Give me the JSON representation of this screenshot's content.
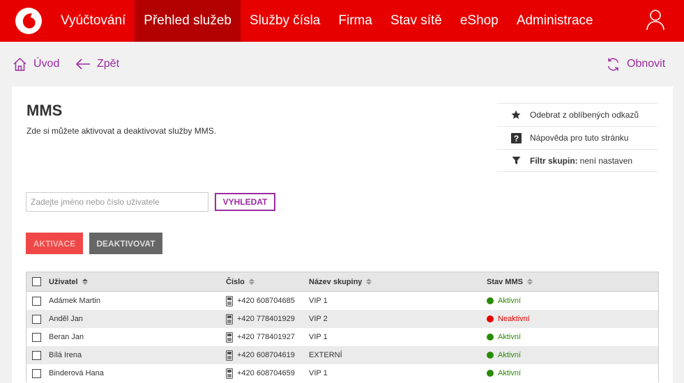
{
  "nav": {
    "items": [
      {
        "label": "Vyúčtování",
        "active": false
      },
      {
        "label": "Přehled služeb",
        "active": true
      },
      {
        "label": "Služby čísla",
        "active": false
      },
      {
        "label": "Firma",
        "active": false
      },
      {
        "label": "Stav sítě",
        "active": false
      },
      {
        "label": "eShop",
        "active": false
      },
      {
        "label": "Administrace",
        "active": false
      }
    ]
  },
  "breadcrumb": {
    "home": "Úvod",
    "back": "Zpět",
    "refresh": "Obnovit"
  },
  "page": {
    "title": "MMS",
    "description": "Zde si můžete aktivovat a deaktivovat služby MMS."
  },
  "sidebar": {
    "favorite": "Odebrat z oblíbených odkazů",
    "help": "Nápověda pro tuto stránku",
    "filter_label": "Filtr skupin:",
    "filter_value": "není nastaven"
  },
  "search": {
    "placeholder": "Zadejte jméno nebo číslo uživatele",
    "value": "",
    "button": "VYHLEDAT"
  },
  "actions": {
    "activate": "AKTIVACE",
    "deactivate": "DEAKTIVOVAT"
  },
  "table": {
    "headers": {
      "user": "Uživatel",
      "number": "Číslo",
      "group": "Název skupiny",
      "status": "Stav MMS"
    },
    "rows": [
      {
        "user": "Adámek Martin",
        "number": "+420 608704685",
        "group": "VIP 1",
        "status": "Aktivní",
        "active": true
      },
      {
        "user": "Anděl Jan",
        "number": "+420 778401929",
        "group": "VIP 2",
        "status": "Neaktivní",
        "active": false
      },
      {
        "user": "Beran Jan",
        "number": "+420 778401927",
        "group": "VIP 1",
        "status": "Aktivní",
        "active": true
      },
      {
        "user": "Bílá Irena",
        "number": "+420 608704619",
        "group": "EXTERNÍ",
        "status": "Aktivní",
        "active": true
      },
      {
        "user": "Binderová Hana",
        "number": "+420 608704659",
        "group": "VIP 1",
        "status": "Aktivní",
        "active": true
      }
    ]
  },
  "colors": {
    "brand": "#e60000",
    "brand_dark": "#b30000",
    "accent": "#9c2aa0",
    "active_status": "#2a8a00",
    "inactive_status": "#e60000"
  }
}
